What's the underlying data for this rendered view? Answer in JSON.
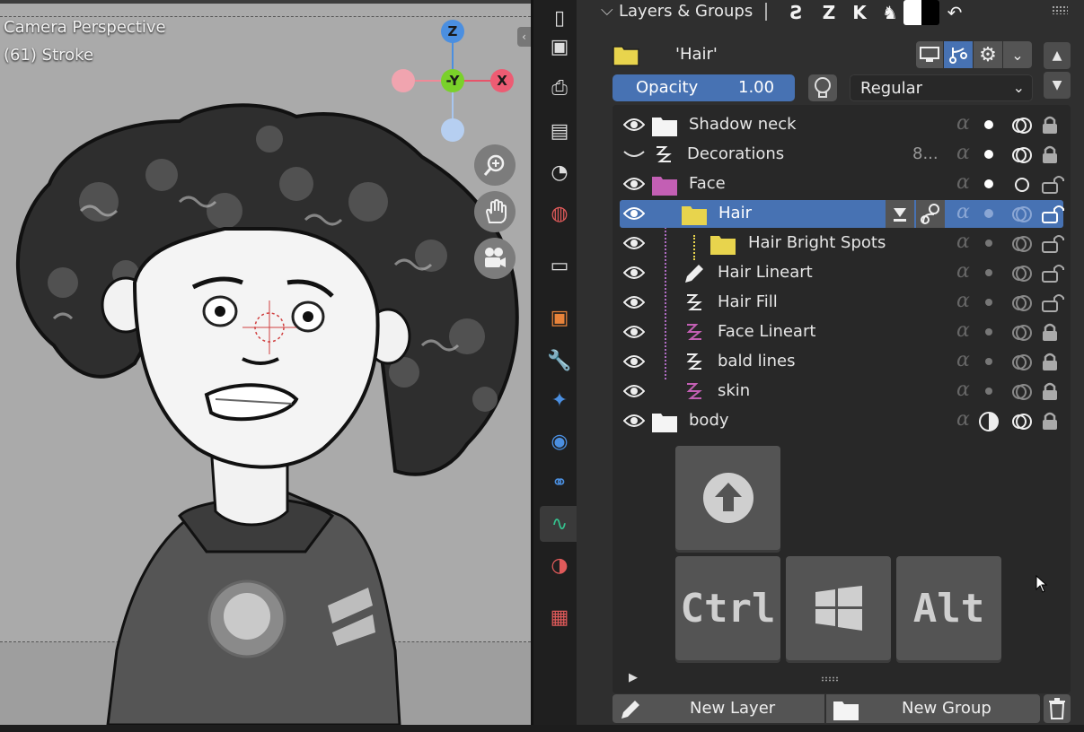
{
  "viewport": {
    "view_name": "Camera Perspective",
    "object_info": "(61) Stroke",
    "gizmo": {
      "z": "Z",
      "y": "-Y",
      "x": "X"
    }
  },
  "tabs": [
    "render-icon",
    "output-icon",
    "view-layer-icon",
    "scene-icon",
    "world-icon",
    "collection-icon",
    "object-icon",
    "modifier-icon",
    "particles-icon",
    "physics-icon",
    "constraints-icon",
    "grease-pencil-data-icon",
    "material-icon",
    "texture-icon"
  ],
  "panel": {
    "title": "Layers & Groups",
    "active_layer_name": "'Hair'",
    "opacity_label": "Opacity",
    "opacity_value": "1.00",
    "blend_mode": "Regular",
    "layers": [
      {
        "name": "Shadow neck",
        "type": "group",
        "visible": true,
        "locked": true
      },
      {
        "name": "Decorations",
        "type": "layer",
        "visible": false,
        "count": "8...",
        "locked": true
      },
      {
        "name": "Face",
        "type": "group",
        "color": "#c35fb4",
        "visible": true,
        "locked": false
      },
      {
        "name": "Hair",
        "type": "group",
        "color": "#e8d44d",
        "visible": true,
        "selected": true,
        "locked": false
      },
      {
        "name": "Hair Bright Spots",
        "type": "group",
        "color": "#e8d44d",
        "visible": true,
        "locked": false
      },
      {
        "name": "Hair Lineart",
        "type": "layer",
        "visible": true,
        "locked": false
      },
      {
        "name": "Hair Fill",
        "type": "layer",
        "visible": true,
        "locked": false
      },
      {
        "name": "Face Lineart",
        "type": "layer",
        "color": "#c35fb4",
        "visible": true,
        "locked": true
      },
      {
        "name": "bald lines",
        "type": "layer",
        "visible": true,
        "locked": true
      },
      {
        "name": "skin",
        "type": "layer",
        "color": "#c35fb4",
        "visible": true,
        "locked": true
      },
      {
        "name": "body",
        "type": "group",
        "visible": true,
        "locked": true
      }
    ],
    "keys": {
      "ctrl": "Ctrl",
      "alt": "Alt"
    },
    "new_layer_label": "New Layer",
    "new_group_label": "New Group"
  },
  "colors": {
    "accent": "#4772b3",
    "group_face": "#c35fb4",
    "group_hair": "#e8d44d",
    "panel_bg": "#2f2f2f",
    "viewport_bg": "#aaaaaa"
  }
}
